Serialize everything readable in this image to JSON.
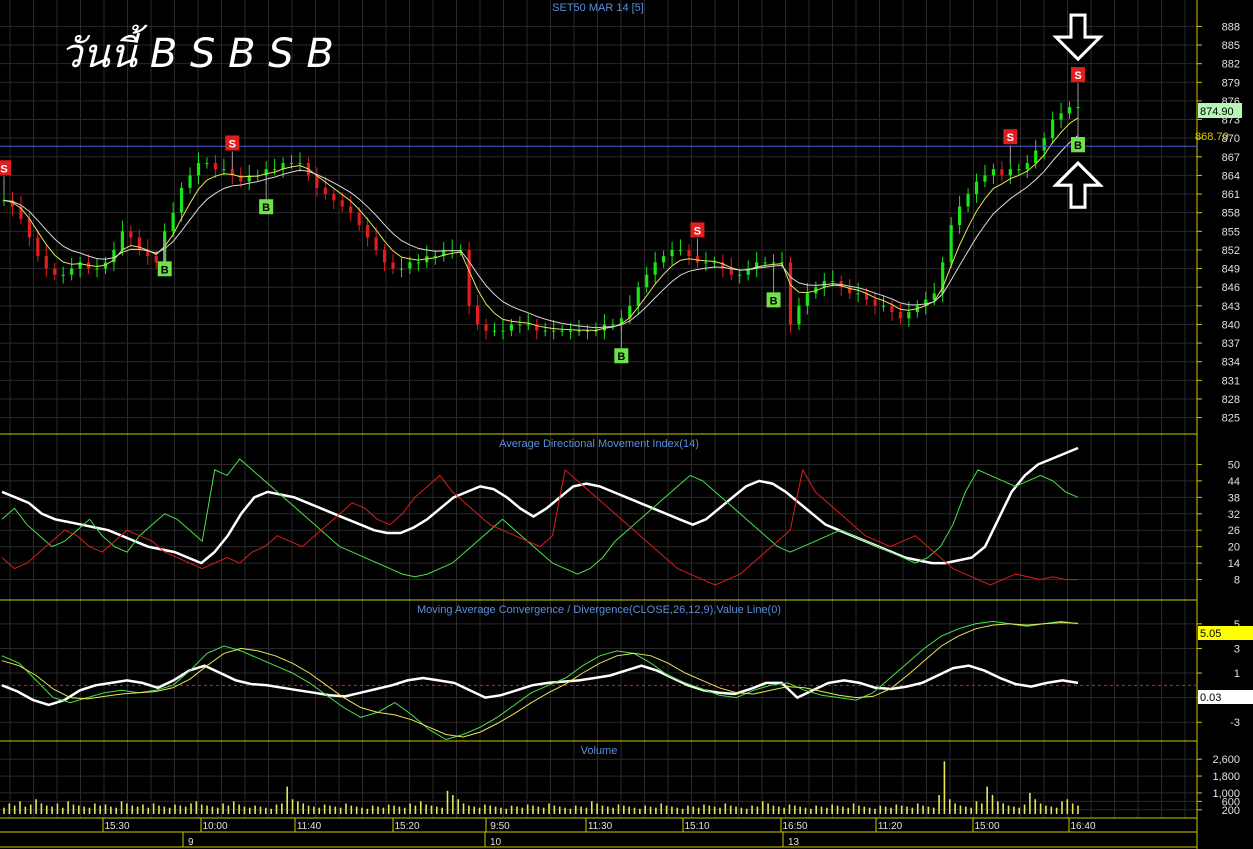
{
  "header": {
    "title": "SET50 MAR 14   [5]",
    "headline": "วันนี้ B S B S B"
  },
  "colors": {
    "background": "#000000",
    "grid": "#2a2a2a",
    "frame": "#c8c800",
    "bull": "#19e619",
    "bear": "#e01e1e",
    "ma": "#e6e65a",
    "title": "#5b8fd9",
    "white": "#ffffff",
    "buy_badge": "#6fe24a",
    "sell_badge": "#e01e1e",
    "price_pill": "#b8f5b8",
    "macd_pill": "#ffff00"
  },
  "chart_data": [
    {
      "type": "candlestick",
      "title": "SET50 MAR 14   [5]",
      "y_ticks": [
        "888",
        "885",
        "882",
        "879",
        "876",
        "873",
        "870",
        "867",
        "864",
        "861",
        "858",
        "855",
        "852",
        "849",
        "846",
        "843",
        "840",
        "837",
        "834",
        "831",
        "828",
        "825"
      ],
      "ylim": [
        823,
        890
      ],
      "last_price": "874.90",
      "ref_line_label": "868.70",
      "ref_line": 868.7,
      "close_series": [
        860,
        859,
        857,
        854,
        851,
        849,
        848,
        848,
        849,
        850,
        849,
        849,
        850,
        852,
        855,
        854,
        852,
        851,
        850,
        855,
        858,
        862,
        864,
        866,
        866,
        865,
        865,
        864,
        863,
        864,
        864,
        865,
        865,
        866,
        866,
        866,
        864,
        862,
        861,
        860,
        859,
        858,
        856,
        854,
        852,
        850,
        849,
        849,
        850,
        850,
        851,
        851,
        852,
        852,
        852,
        843,
        840,
        839,
        839,
        839,
        840,
        840,
        840,
        839,
        839,
        839,
        839,
        839,
        839,
        839,
        839,
        840,
        840,
        841,
        843,
        846,
        848,
        850,
        851,
        852,
        852,
        851,
        850,
        850,
        850,
        849,
        848,
        848,
        849,
        850,
        850,
        850,
        850,
        840,
        843,
        845,
        846,
        847,
        847,
        846,
        845,
        845,
        844,
        843,
        843,
        842,
        841,
        842,
        843,
        844,
        845,
        850,
        856,
        859,
        861,
        863,
        864,
        865,
        864,
        865,
        865,
        866,
        868,
        870,
        873,
        874,
        875,
        875
      ],
      "signals": [
        {
          "label": "S",
          "kind": "sell",
          "index": 0
        },
        {
          "label": "B",
          "kind": "buy",
          "index": 19
        },
        {
          "label": "S",
          "kind": "sell",
          "index": 27
        },
        {
          "label": "B",
          "kind": "buy",
          "index": 31
        },
        {
          "label": "B",
          "kind": "buy",
          "index": 73
        },
        {
          "label": "S",
          "kind": "sell",
          "index": 82
        },
        {
          "label": "B",
          "kind": "buy",
          "index": 91
        },
        {
          "label": "S",
          "kind": "sell",
          "index": 119
        },
        {
          "label": "S",
          "kind": "sell",
          "index": 137
        },
        {
          "label": "B",
          "kind": "buy",
          "index": 136
        },
        {
          "label": "B",
          "kind": "buy",
          "index": 151
        },
        {
          "label": "S",
          "kind": "sell",
          "index": 171
        },
        {
          "label": "B",
          "kind": "buy",
          "index": 173
        }
      ],
      "arrows": [
        {
          "dir": "down",
          "index": 136
        },
        {
          "dir": "up",
          "index": 136
        },
        {
          "dir": "up",
          "index": 151
        },
        {
          "dir": "down",
          "index": 169
        },
        {
          "dir": "up",
          "index": 173
        }
      ]
    },
    {
      "type": "line",
      "title": "Average Directional Movement Index(14)",
      "y_ticks": [
        "50",
        "44",
        "38",
        "32",
        "26",
        "20",
        "14",
        "8"
      ],
      "ylim": [
        2,
        56
      ],
      "series": [
        {
          "color": "white",
          "values": [
            40,
            38,
            36,
            32,
            30,
            29,
            28,
            27,
            26,
            24,
            22,
            20,
            19,
            18,
            16,
            14,
            18,
            24,
            32,
            38,
            40,
            39,
            38,
            36,
            34,
            32,
            30,
            28,
            26,
            25,
            25,
            27,
            30,
            34,
            38,
            40,
            42,
            41,
            38,
            34,
            31,
            34,
            38,
            42,
            43,
            42,
            40,
            38,
            36,
            34,
            32,
            30,
            28,
            30,
            34,
            38,
            42,
            44,
            43,
            40,
            36,
            32,
            28,
            26,
            24,
            22,
            20,
            18,
            16,
            15,
            14,
            14,
            15,
            16,
            20,
            30,
            40,
            46,
            50,
            52,
            54,
            56
          ]
        },
        {
          "color": "green",
          "values": [
            30,
            34,
            28,
            24,
            20,
            22,
            26,
            30,
            24,
            20,
            18,
            24,
            28,
            32,
            30,
            26,
            22,
            48,
            46,
            52,
            48,
            44,
            40,
            36,
            32,
            28,
            24,
            20,
            18,
            16,
            14,
            12,
            10,
            9,
            10,
            12,
            14,
            18,
            22,
            26,
            30,
            26,
            22,
            18,
            14,
            12,
            10,
            12,
            16,
            22,
            26,
            30,
            34,
            38,
            42,
            46,
            44,
            40,
            36,
            32,
            28,
            24,
            20,
            18,
            20,
            22,
            24,
            26,
            24,
            22,
            20,
            18,
            16,
            14,
            16,
            20,
            28,
            40,
            48,
            46,
            44,
            42,
            44,
            46,
            44,
            40,
            38
          ]
        },
        {
          "color": "red",
          "values": [
            16,
            12,
            14,
            18,
            22,
            26,
            24,
            20,
            18,
            22,
            26,
            24,
            22,
            18,
            16,
            14,
            12,
            14,
            16,
            14,
            18,
            20,
            24,
            22,
            20,
            24,
            28,
            32,
            36,
            34,
            30,
            28,
            32,
            38,
            42,
            46,
            40,
            36,
            32,
            28,
            26,
            24,
            22,
            20,
            24,
            48,
            44,
            40,
            36,
            32,
            28,
            24,
            20,
            16,
            12,
            10,
            8,
            6,
            8,
            10,
            14,
            18,
            22,
            26,
            48,
            40,
            36,
            32,
            28,
            24,
            22,
            20,
            22,
            24,
            20,
            16,
            12,
            10,
            8,
            6,
            8,
            10,
            9,
            8,
            9,
            8,
            8
          ]
        }
      ]
    },
    {
      "type": "line",
      "title": "Moving Average Convergence / Divergence(CLOSE,26,12,9),Value Line(0)",
      "y_ticks": [
        "5",
        "3",
        "1",
        "-1",
        "-3"
      ],
      "ylim": [
        -4.2,
        5.8
      ],
      "last_values": [
        "5.05",
        "0.03"
      ],
      "series": [
        {
          "color": "white",
          "values": [
            0,
            -0.5,
            -1.2,
            -1.6,
            -1.2,
            -0.4,
            0,
            0.2,
            0.4,
            0.2,
            -0.2,
            0.4,
            1.2,
            1.6,
            1.0,
            0.4,
            0.1,
            0,
            -0.2,
            -0.4,
            -0.6,
            -0.8,
            -0.9,
            -0.6,
            -0.3,
            0,
            0.4,
            0.6,
            0.4,
            0.2,
            -0.4,
            -1.0,
            -0.8,
            -0.4,
            0,
            0.2,
            0.3,
            0.4,
            0.6,
            0.8,
            1.2,
            1.6,
            1.2,
            0.6,
            0,
            -0.4,
            -0.6,
            -0.7,
            -0.3,
            0.2,
            0.2,
            -1.0,
            -0.4,
            0.2,
            0.4,
            0.2,
            -0.2,
            -0.3,
            -0.1,
            0.2,
            0.8,
            1.4,
            1.6,
            1.2,
            0.6,
            0.1,
            -0.1,
            0.2,
            0.4,
            0.2
          ]
        },
        {
          "color": "green",
          "values": [
            2.4,
            1.8,
            0.4,
            -1.0,
            -1.4,
            -1.0,
            -0.6,
            -0.4,
            -0.6,
            -0.4,
            0,
            1.2,
            2.6,
            3.2,
            2.8,
            2.2,
            1.6,
            1.0,
            0.2,
            -0.8,
            -1.8,
            -2.6,
            -2.2,
            -1.4,
            -2.4,
            -3.6,
            -4.4,
            -4.0,
            -3.4,
            -2.6,
            -1.6,
            -0.6,
            0,
            0.6,
            1.6,
            2.4,
            2.8,
            2.6,
            1.8,
            0.8,
            0.2,
            -0.3,
            -0.8,
            -1.0,
            -0.4,
            0,
            0.2,
            -0.4,
            -0.8,
            -1.0,
            -1.2,
            -0.6,
            0.6,
            1.8,
            3.0,
            4.0,
            4.6,
            5.0,
            5.2,
            5.0,
            4.8,
            5.0,
            5.2,
            5.0
          ]
        },
        {
          "color": "yellow",
          "values": [
            2.0,
            1.6,
            0.8,
            -0.3,
            -1.0,
            -1.1,
            -0.9,
            -0.7,
            -0.6,
            -0.5,
            -0.2,
            0.5,
            1.6,
            2.6,
            3.0,
            2.8,
            2.4,
            1.8,
            1.0,
            0,
            -1.0,
            -1.8,
            -2.2,
            -2.4,
            -2.8,
            -3.4,
            -4.0,
            -4.2,
            -3.8,
            -3.1,
            -2.3,
            -1.4,
            -0.6,
            0.1,
            1.0,
            1.8,
            2.4,
            2.6,
            2.4,
            1.8,
            1.0,
            0.4,
            -0.2,
            -0.6,
            -0.7,
            -0.4,
            -0.1,
            -0.2,
            -0.5,
            -0.8,
            -1.0,
            -0.9,
            -0.3,
            0.8,
            2.0,
            3.2,
            4.0,
            4.6,
            4.9,
            5.0,
            4.9,
            5.0,
            5.1,
            5.05
          ]
        }
      ],
      "zero_line": 0
    },
    {
      "type": "bar",
      "title": "Volume",
      "y_ticks": [
        "2,600",
        "1,800",
        "1,000",
        "600",
        "200"
      ],
      "ylim": [
        0,
        2800
      ],
      "values": [
        300,
        500,
        400,
        600,
        350,
        450,
        700,
        500,
        400,
        350,
        500,
        300,
        600,
        450,
        400,
        350,
        300,
        500,
        400,
        450,
        350,
        300,
        600,
        500,
        400,
        350,
        450,
        300,
        500,
        400,
        350,
        300,
        450,
        400,
        350,
        500,
        600,
        450,
        400,
        350,
        300,
        500,
        400,
        600,
        450,
        350,
        300,
        400,
        350,
        300,
        250,
        450,
        500,
        1300,
        700,
        600,
        500,
        400,
        350,
        300,
        450,
        400,
        350,
        300,
        500,
        400,
        350,
        300,
        250,
        400,
        350,
        300,
        450,
        400,
        350,
        300,
        500,
        400,
        600,
        450,
        400,
        350,
        300,
        1100,
        900,
        700,
        500,
        400,
        350,
        300,
        450,
        400,
        350,
        300,
        250,
        400,
        350,
        300,
        450,
        400,
        350,
        300,
        500,
        400,
        350,
        300,
        250,
        400,
        350,
        300,
        600,
        500,
        400,
        350,
        300,
        450,
        400,
        350,
        300,
        250,
        400,
        350,
        300,
        500,
        400,
        350,
        300,
        250,
        400,
        350,
        300,
        450,
        400,
        350,
        300,
        500,
        400,
        350,
        300,
        250,
        400,
        350,
        600,
        500,
        400,
        350,
        300,
        450,
        400,
        350,
        300,
        250,
        400,
        350,
        300,
        450,
        400,
        350,
        300,
        500,
        400,
        350,
        300,
        250,
        400,
        350,
        300,
        450,
        400,
        350,
        300,
        500,
        400,
        350,
        300,
        900,
        2500,
        700,
        500,
        400,
        350,
        300,
        600,
        500,
        1300,
        900,
        600,
        500,
        400,
        350,
        300,
        450,
        1000,
        700,
        500,
        400,
        350,
        300,
        600,
        700,
        500,
        400
      ]
    }
  ],
  "x_axis": {
    "time_labels": [
      "15:30",
      "10:00",
      "11:40",
      "15:20",
      "9:50",
      "11:30",
      "15:10",
      "16:50",
      "11:20",
      "15:00",
      "16:40"
    ],
    "day_labels": [
      "9",
      "10",
      "13"
    ]
  }
}
